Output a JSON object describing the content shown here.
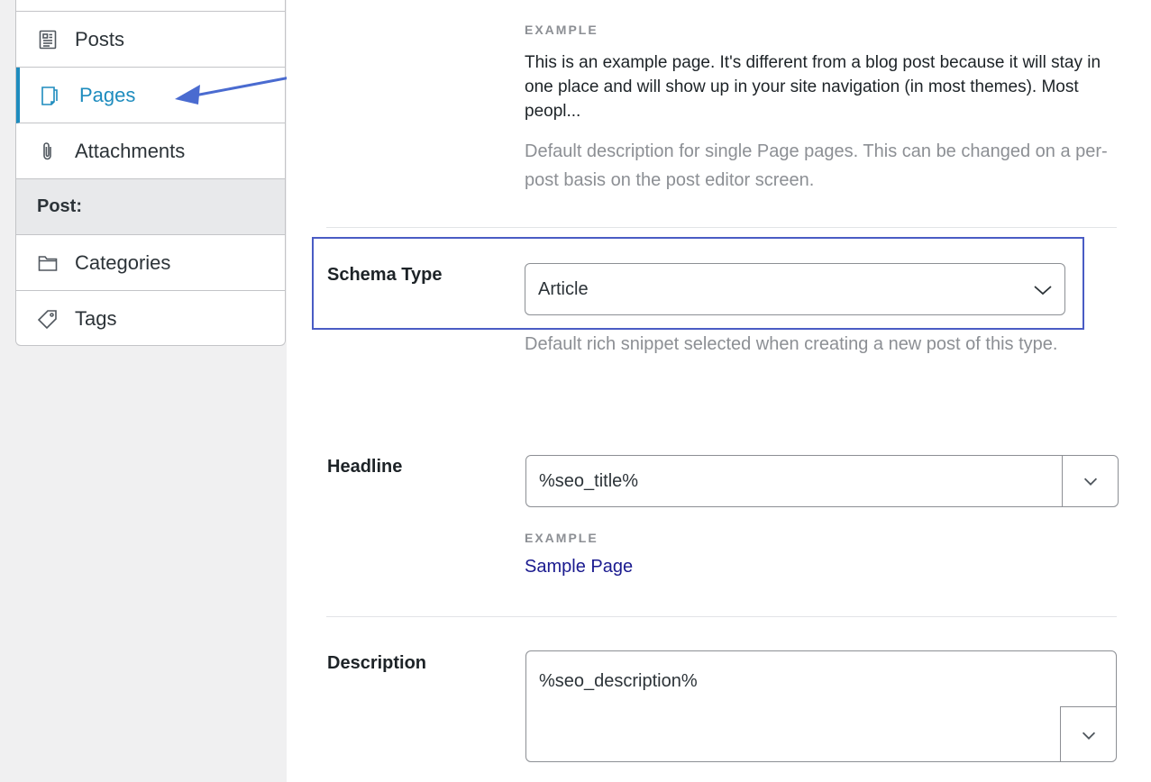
{
  "sidebar": {
    "items": [
      {
        "label": "Posts",
        "icon": "posts-icon"
      },
      {
        "label": "Pages",
        "icon": "page-icon",
        "active": true
      },
      {
        "label": "Attachments",
        "icon": "paperclip-icon"
      }
    ],
    "section_label": "Post:",
    "taxonomies": [
      {
        "label": "Categories",
        "icon": "folder-icon"
      },
      {
        "label": "Tags",
        "icon": "tag-icon"
      }
    ]
  },
  "main": {
    "example_label": "EXAMPLE",
    "example_text": "This is an example page. It's different from a blog post because it will stay in one place and will show up in your site navigation (in most themes). Most peopl...",
    "default_description": "Default description for single Page pages. This can be changed on a per-post basis on the post editor screen.",
    "schema": {
      "label": "Schema Type",
      "value": "Article",
      "help": "Default rich snippet selected when creating a new post of this type."
    },
    "headline": {
      "label": "Headline",
      "value": "%seo_title%",
      "example_label": "EXAMPLE",
      "example_value": "Sample Page"
    },
    "description": {
      "label": "Description",
      "value": "%seo_description%"
    }
  },
  "colors": {
    "accent": "#1e8cbe",
    "highlight_border": "#4a5cc4",
    "arrow": "#4a6bd0"
  }
}
